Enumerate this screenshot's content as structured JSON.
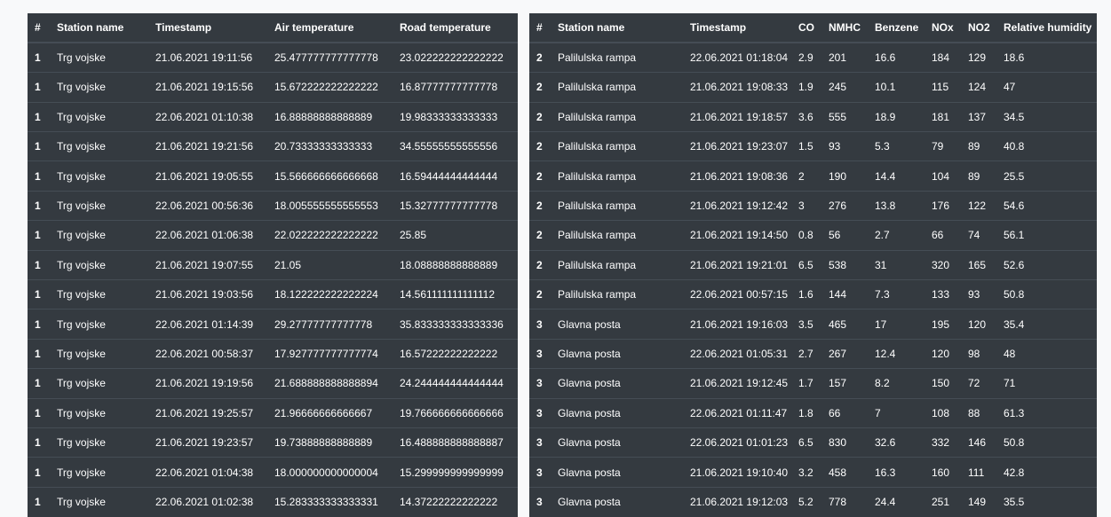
{
  "left_table": {
    "headers": [
      "#",
      "Station name",
      "Timestamp",
      "Air temperature",
      "Road temperature"
    ],
    "rows": [
      [
        "1",
        "Trg vojske",
        "21.06.2021 19:11:56",
        "25.477777777777778",
        "23.022222222222222"
      ],
      [
        "1",
        "Trg vojske",
        "21.06.2021 19:15:56",
        "15.672222222222222",
        "16.87777777777778"
      ],
      [
        "1",
        "Trg vojske",
        "22.06.2021 01:10:38",
        "16.88888888888889",
        "19.98333333333333"
      ],
      [
        "1",
        "Trg vojske",
        "21.06.2021 19:21:56",
        "20.73333333333333",
        "34.55555555555556"
      ],
      [
        "1",
        "Trg vojske",
        "21.06.2021 19:05:55",
        "15.566666666666668",
        "16.59444444444444"
      ],
      [
        "1",
        "Trg vojske",
        "22.06.2021 00:56:36",
        "18.005555555555553",
        "15.32777777777778"
      ],
      [
        "1",
        "Trg vojske",
        "22.06.2021 01:06:38",
        "22.022222222222222",
        "25.85"
      ],
      [
        "1",
        "Trg vojske",
        "21.06.2021 19:07:55",
        "21.05",
        "18.08888888888889"
      ],
      [
        "1",
        "Trg vojske",
        "21.06.2021 19:03:56",
        "18.122222222222224",
        "14.561111111111112"
      ],
      [
        "1",
        "Trg vojske",
        "22.06.2021 01:14:39",
        "29.27777777777778",
        "35.833333333333336"
      ],
      [
        "1",
        "Trg vojske",
        "22.06.2021 00:58:37",
        "17.927777777777774",
        "16.57222222222222"
      ],
      [
        "1",
        "Trg vojske",
        "21.06.2021 19:19:56",
        "21.688888888888894",
        "24.244444444444444"
      ],
      [
        "1",
        "Trg vojske",
        "21.06.2021 19:25:57",
        "21.96666666666667",
        "19.766666666666666"
      ],
      [
        "1",
        "Trg vojske",
        "21.06.2021 19:23:57",
        "19.73888888888889",
        "16.488888888888887"
      ],
      [
        "1",
        "Trg vojske",
        "22.06.2021 01:04:38",
        "18.000000000000004",
        "15.299999999999999"
      ],
      [
        "1",
        "Trg vojske",
        "22.06.2021 01:02:38",
        "15.283333333333331",
        "14.37222222222222"
      ]
    ]
  },
  "right_table": {
    "headers": [
      "#",
      "Station name",
      "Timestamp",
      "CO",
      "NMHC",
      "Benzene",
      "NOx",
      "NO2",
      "Relative humidity"
    ],
    "rows": [
      [
        "2",
        "Palilulska rampa",
        "22.06.2021 01:18:04",
        "2.9",
        "201",
        "16.6",
        "184",
        "129",
        "18.6"
      ],
      [
        "2",
        "Palilulska rampa",
        "21.06.2021 19:08:33",
        "1.9",
        "245",
        "10.1",
        "115",
        "124",
        "47"
      ],
      [
        "2",
        "Palilulska rampa",
        "21.06.2021 19:18:57",
        "3.6",
        "555",
        "18.9",
        "181",
        "137",
        "34.5"
      ],
      [
        "2",
        "Palilulska rampa",
        "21.06.2021 19:23:07",
        "1.5",
        "93",
        "5.3",
        "79",
        "89",
        "40.8"
      ],
      [
        "2",
        "Palilulska rampa",
        "21.06.2021 19:08:36",
        "2",
        "190",
        "14.4",
        "104",
        "89",
        "25.5"
      ],
      [
        "2",
        "Palilulska rampa",
        "21.06.2021 19:12:42",
        "3",
        "276",
        "13.8",
        "176",
        "122",
        "54.6"
      ],
      [
        "2",
        "Palilulska rampa",
        "21.06.2021 19:14:50",
        "0.8",
        "56",
        "2.7",
        "66",
        "74",
        "56.1"
      ],
      [
        "2",
        "Palilulska rampa",
        "21.06.2021 19:21:01",
        "6.5",
        "538",
        "31",
        "320",
        "165",
        "52.6"
      ],
      [
        "2",
        "Palilulska rampa",
        "22.06.2021 00:57:15",
        "1.6",
        "144",
        "7.3",
        "133",
        "93",
        "50.8"
      ],
      [
        "3",
        "Glavna posta",
        "21.06.2021 19:16:03",
        "3.5",
        "465",
        "17",
        "195",
        "120",
        "35.4"
      ],
      [
        "3",
        "Glavna posta",
        "22.06.2021 01:05:31",
        "2.7",
        "267",
        "12.4",
        "120",
        "98",
        "48"
      ],
      [
        "3",
        "Glavna posta",
        "21.06.2021 19:12:45",
        "1.7",
        "157",
        "8.2",
        "150",
        "72",
        "71"
      ],
      [
        "3",
        "Glavna posta",
        "22.06.2021 01:11:47",
        "1.8",
        "66",
        "7",
        "108",
        "88",
        "61.3"
      ],
      [
        "3",
        "Glavna posta",
        "22.06.2021 01:01:23",
        "6.5",
        "830",
        "32.6",
        "332",
        "146",
        "50.8"
      ],
      [
        "3",
        "Glavna posta",
        "21.06.2021 19:10:40",
        "3.2",
        "458",
        "16.3",
        "160",
        "111",
        "42.8"
      ],
      [
        "3",
        "Glavna posta",
        "21.06.2021 19:12:03",
        "5.2",
        "778",
        "24.4",
        "251",
        "149",
        "35.5"
      ]
    ]
  }
}
